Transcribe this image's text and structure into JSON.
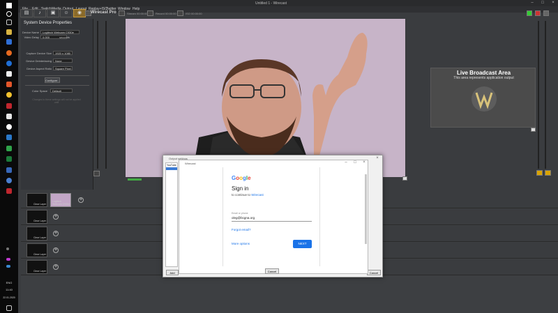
{
  "window": {
    "title": "Untitled 1 - Wirecast"
  },
  "taskbar": {
    "time": "11:40",
    "lang": "ENG",
    "date": "22.01.2020",
    "tray_text": "ENG"
  },
  "menu": [
    "File",
    "Edit",
    "Switch",
    "Media",
    "Output",
    "Layout",
    "Replay+ISO",
    "Twitter",
    "Window",
    "Help"
  ],
  "brand": "Wirecast Pro",
  "timecodes": {
    "stream": "Stream 00:00:00",
    "record": "Record 00:00:00",
    "iso": "ISO 00:00:00"
  },
  "properties": {
    "heading": "System Device Properties",
    "device_name_label": "Device Name",
    "device_name_value": "Logitech Webcam C930e",
    "video_delay_label": "Video Delay",
    "video_delay_value": "0.000",
    "video_delay_unit": "seconds",
    "capture_size_label": "Capture Device Size",
    "capture_size_value": "1920 x 1080",
    "deinterlacing_label": "Device Deinterlacing",
    "deinterlacing_value": "None",
    "aspect_label": "Device Aspect Ratio",
    "aspect_value": "Square Pixel",
    "configure_label": "Configure...",
    "colorspace_label": "Color Space",
    "colorspace_value": "Default",
    "hint": "Changes to these settings will not be applied until"
  },
  "live": {
    "title": "Live Broadcast Area",
    "subtitle": "This area represents application output"
  },
  "layers": [
    {
      "caption": "Clear Layer",
      "shot": "Logitech Webcam C930e"
    },
    {
      "caption": "Clear Layer"
    },
    {
      "caption": "Clear Layer"
    },
    {
      "caption": "Clear Layer"
    },
    {
      "caption": "Clear Layer"
    }
  ],
  "dialog": {
    "outer_title": "Output settings",
    "destination": "YouTube",
    "inner_title": "Wirecast",
    "google": "Google",
    "heading": "Sign in",
    "subheading_prefix": "to continue to",
    "subheading_app": "Wirecast",
    "email_label": "Email or phone",
    "email_value": "oleg@bcgna.org",
    "forgot": "Forgot email?",
    "more_options": "More options",
    "next": "NEXT",
    "cancel": "Cancel",
    "add": "Add",
    "outer_cancel": "Cancel"
  },
  "colors": {
    "accent_blue": "#1a73e8",
    "live_area": "#4b4b4b",
    "preview_wall": "#c6b3c7"
  }
}
